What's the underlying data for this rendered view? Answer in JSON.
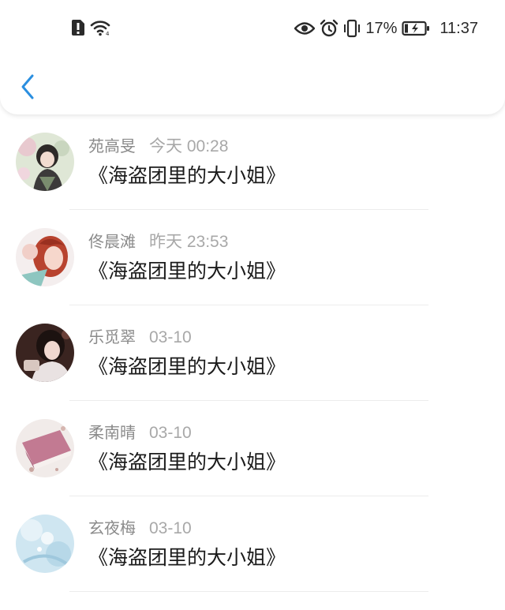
{
  "status_bar": {
    "battery_percent": "17%",
    "time": "11:37",
    "icons": [
      "alert-icon",
      "wifi-icon",
      "eye-icon",
      "alarm-icon",
      "vibrate-icon",
      "battery-charging-icon"
    ]
  },
  "header": {
    "back_icon": "chevron-left-icon",
    "accent_color": "#2b8fe0"
  },
  "items": [
    {
      "name": "苑高旻",
      "time": "今天 00:28",
      "message": "《海盗团里的大小姐》"
    },
    {
      "name": "佟晨滩",
      "time": "昨天 23:53",
      "message": "《海盗团里的大小姐》"
    },
    {
      "name": "乐觅翠",
      "time": "03-10",
      "message": "《海盗团里的大小姐》"
    },
    {
      "name": "柔南晴",
      "time": "03-10",
      "message": "《海盗团里的大小姐》"
    },
    {
      "name": "玄夜梅",
      "time": "03-10",
      "message": "《海盗团里的大小姐》"
    }
  ]
}
